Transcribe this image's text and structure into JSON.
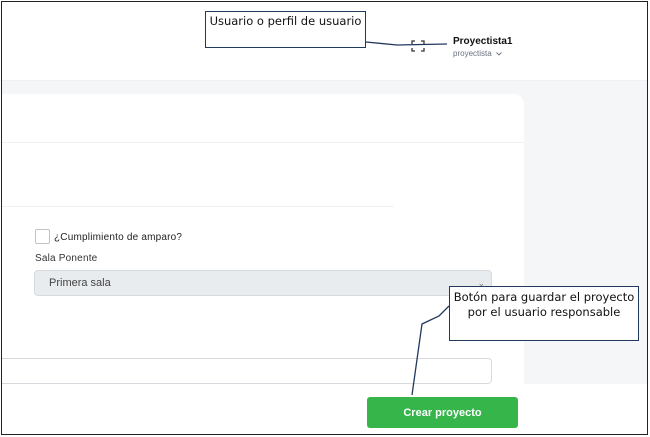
{
  "header": {
    "user_name": "Proyectista1",
    "user_role": "proyectista",
    "role_dropdown_icon": "chevron-down-icon",
    "expand_icon": "expand-icon"
  },
  "form": {
    "amparo_checkbox_label": "¿Cumplimiento de amparo?",
    "amparo_checked": false,
    "sala_label": "Sala Ponente",
    "sala_value": "Primera sala",
    "sala_chevron": "⌄",
    "create_button_label": "Crear proyecto"
  },
  "annotations": {
    "user_callout": "Usuario o perfil de usuario",
    "save_callout": "Botón para guardar el proyecto por el usuario responsable"
  },
  "colors": {
    "primary_button": "#35b54a",
    "callout_border": "#22395e",
    "select_background": "#e9ecef"
  }
}
